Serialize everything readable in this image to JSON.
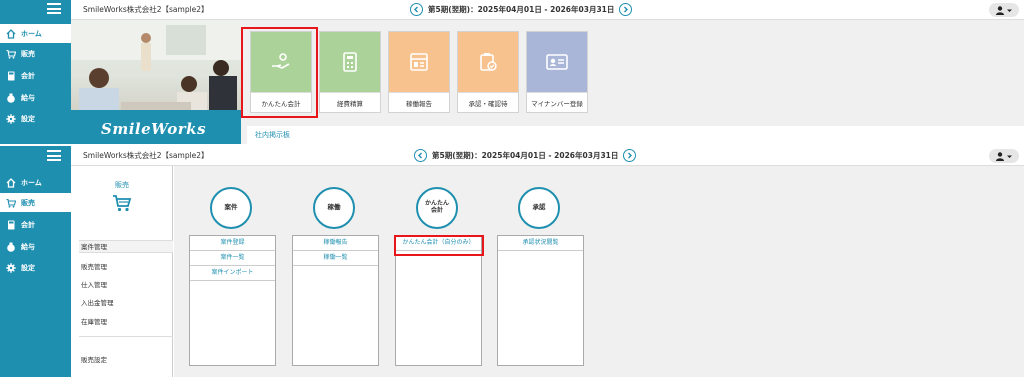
{
  "app": {
    "company": "SmileWorks株式会社2【sample2】",
    "period": "第5期(翌期)：2025年04月01日 - 2026年03月31日",
    "logo": "SmileWorks"
  },
  "sidebar_top": {
    "items": [
      {
        "label": "ホーム",
        "icon": "home-icon"
      },
      {
        "label": "販売",
        "icon": "cart-icon"
      },
      {
        "label": "会計",
        "icon": "calculator-icon"
      },
      {
        "label": "給与",
        "icon": "money-bag-icon"
      },
      {
        "label": "設定",
        "icon": "gear-icon"
      }
    ]
  },
  "sidebar_bottom": {
    "items": [
      {
        "label": "ホーム",
        "icon": "home-icon"
      },
      {
        "label": "販売",
        "icon": "cart-icon"
      },
      {
        "label": "会計",
        "icon": "calculator-icon"
      },
      {
        "label": "給与",
        "icon": "money-bag-icon"
      },
      {
        "label": "設定",
        "icon": "gear-icon"
      }
    ]
  },
  "tiles": [
    {
      "label": "かんたん会計",
      "color": "#abd399"
    },
    {
      "label": "経費精算",
      "color": "#abd399"
    },
    {
      "label": "稼働報告",
      "color": "#f8c28e"
    },
    {
      "label": "承認・確認待",
      "color": "#f8c28e"
    },
    {
      "label": "マイナンバー登録",
      "color": "#a9b6d8"
    }
  ],
  "board": {
    "label": "社内掲示板"
  },
  "sales_panel": {
    "title": "販売",
    "menu": [
      "案件管理",
      "販売管理",
      "仕入管理",
      "入出金管理",
      "在庫管理"
    ],
    "menu2": [
      "販売設定"
    ]
  },
  "categories": [
    {
      "title": "案件",
      "items": [
        "案件登録",
        "案件一覧",
        "案件インポート"
      ]
    },
    {
      "title": "稼働",
      "items": [
        "稼働報告",
        "稼働一覧"
      ]
    },
    {
      "title": "かんたん\n会計",
      "items": [
        "かんたん会計（自分のみ）"
      ]
    },
    {
      "title": "承認",
      "items": [
        "承認状況閲覧"
      ]
    }
  ],
  "colors": {
    "accent": "#1f8fb0",
    "highlight": "#e8151b"
  }
}
